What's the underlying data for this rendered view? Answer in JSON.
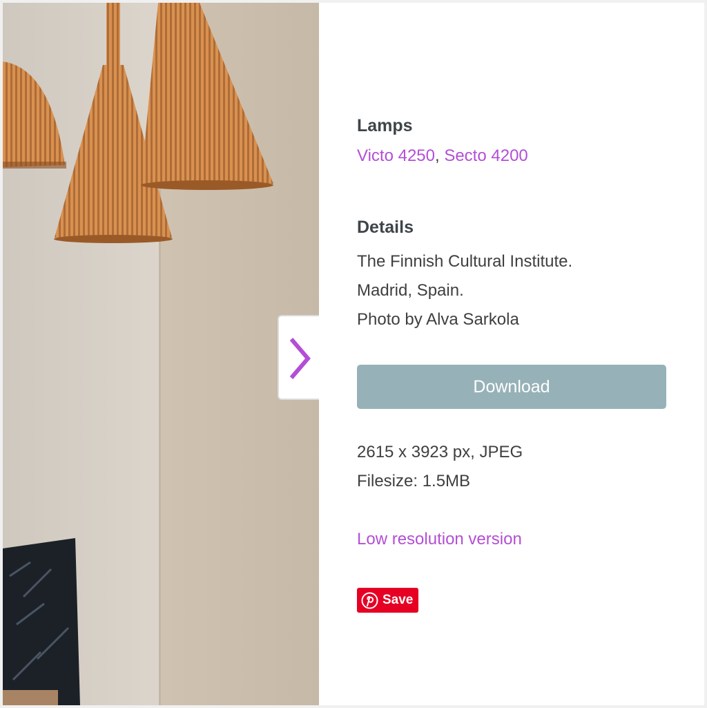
{
  "lamps": {
    "heading": "Lamps",
    "links": [
      "Victo 4250",
      "Secto 4200"
    ],
    "separator": ","
  },
  "details": {
    "heading": "Details",
    "lines": [
      "The Finnish Cultural Institute.",
      "Madrid, Spain.",
      "Photo by Alva Sarkola"
    ]
  },
  "download": {
    "label": "Download"
  },
  "file_info": {
    "dimensions": "2615 x 3923 px, JPEG",
    "filesize": "Filesize: 1.5MB"
  },
  "low_res_link": "Low resolution version",
  "pinterest": {
    "save_label": "Save",
    "color": "#e60023"
  },
  "colors": {
    "accent": "#b34ed6",
    "download_bg": "#97b1b8",
    "heading": "#3e4549"
  },
  "icons": {
    "next": "chevron-right-icon",
    "pinterest": "pinterest-logo-icon"
  }
}
